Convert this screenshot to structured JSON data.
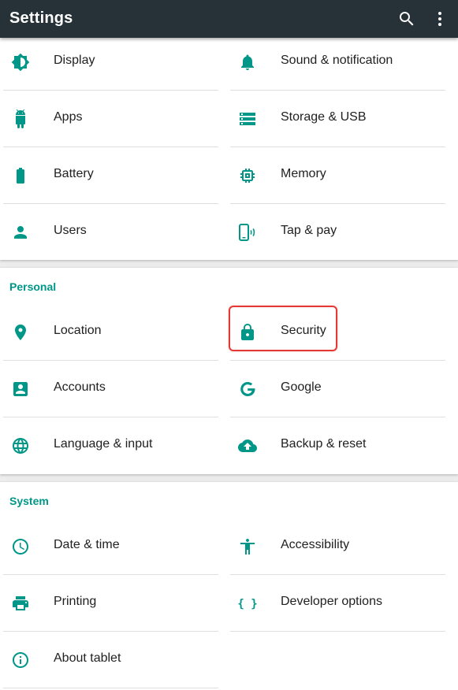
{
  "appbar": {
    "title": "Settings",
    "actions": [
      {
        "name": "search",
        "icon": "search-icon"
      },
      {
        "name": "more",
        "icon": "more-vert-icon"
      }
    ]
  },
  "sections": [
    {
      "header": "",
      "items": [
        {
          "label": "Display",
          "icon": "display-icon"
        },
        {
          "label": "Sound & notification",
          "icon": "bell-icon"
        },
        {
          "label": "Apps",
          "icon": "android-icon"
        },
        {
          "label": "Storage & USB",
          "icon": "storage-icon"
        },
        {
          "label": "Battery",
          "icon": "battery-icon"
        },
        {
          "label": "Memory",
          "icon": "memory-chip-icon"
        },
        {
          "label": "Users",
          "icon": "person-icon"
        },
        {
          "label": "Tap & pay",
          "icon": "tap-pay-icon"
        }
      ]
    },
    {
      "header": "Personal",
      "items": [
        {
          "label": "Location",
          "icon": "location-pin-icon"
        },
        {
          "label": "Security",
          "icon": "lock-icon",
          "highlighted": true
        },
        {
          "label": "Accounts",
          "icon": "account-box-icon"
        },
        {
          "label": "Google",
          "icon": "google-g-icon"
        },
        {
          "label": "Language & input",
          "icon": "globe-icon"
        },
        {
          "label": "Backup & reset",
          "icon": "cloud-upload-icon"
        }
      ]
    },
    {
      "header": "System",
      "items": [
        {
          "label": "Date & time",
          "icon": "clock-icon"
        },
        {
          "label": "Accessibility",
          "icon": "accessibility-icon"
        },
        {
          "label": "Printing",
          "icon": "printer-icon"
        },
        {
          "label": "Developer options",
          "icon": "braces-icon"
        },
        {
          "label": "About tablet",
          "icon": "info-icon"
        }
      ]
    }
  ],
  "colors": {
    "appbar": "#263238",
    "accent": "#009688",
    "highlight": "#e53935"
  }
}
